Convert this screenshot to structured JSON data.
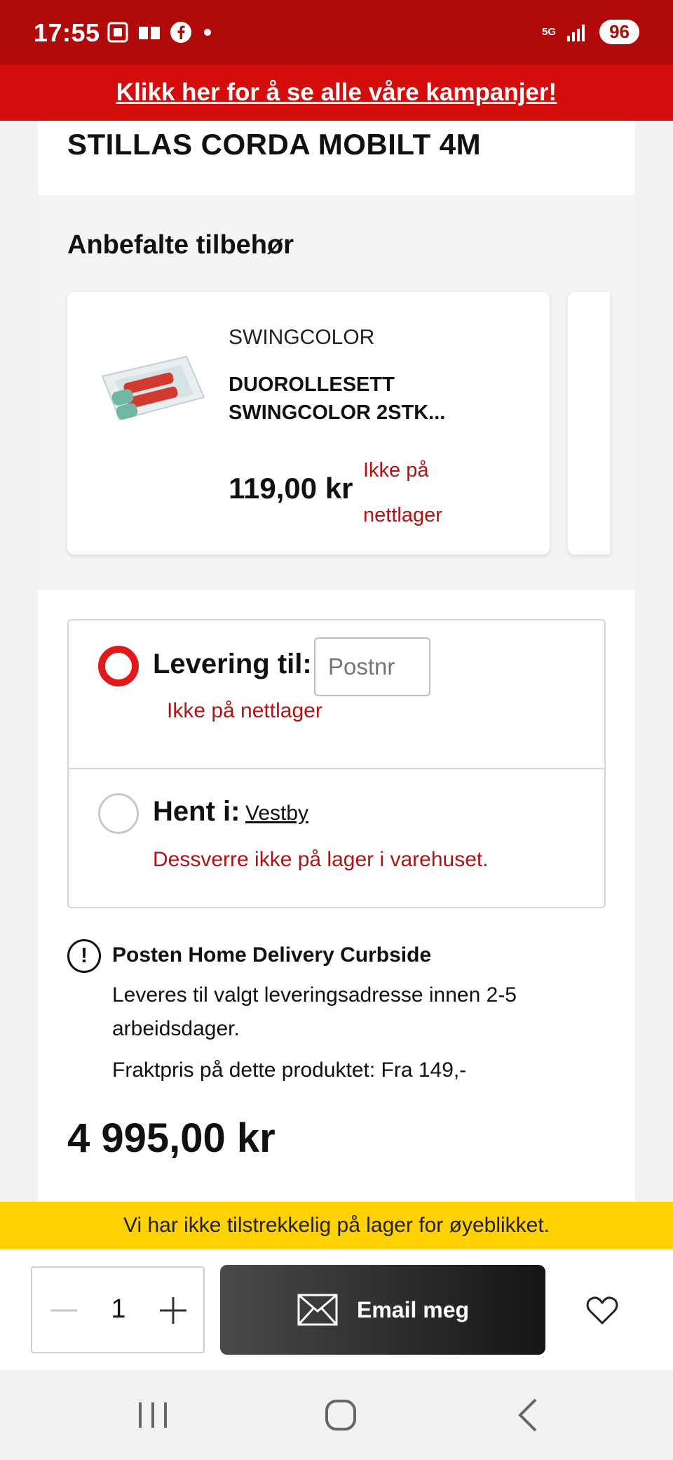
{
  "status_bar": {
    "time": "17:55",
    "network": "5G",
    "battery": "96"
  },
  "campaign_banner": {
    "text": "Klikk her for å se alle våre kampanjer!"
  },
  "product": {
    "title": "STILLAS CORDA MOBILT 4M",
    "price": "4 995,00 kr"
  },
  "accessories": {
    "heading": "Anbefalte tilbehør",
    "items": [
      {
        "brand": "SWINGCOLOR",
        "name": "DUOROLLESETT SWINGCOLOR 2STK...",
        "price": "119,00 kr",
        "stock": "Ikke på nettlager"
      }
    ]
  },
  "delivery": {
    "deliver_label": "Levering til:",
    "postnr_placeholder": "Postnr",
    "deliver_note": "Ikke på nettlager",
    "pickup_label": "Hent i:",
    "pickup_store": "Vestby",
    "pickup_note": "Dessverre ikke på lager i varehuset."
  },
  "shipping_info": {
    "title": "Posten Home Delivery Curbside",
    "text": "Leveres til valgt leveringsadresse innen 2-5 arbeidsdager.",
    "freight": "Fraktpris på dette produktet: Fra 149,-"
  },
  "stock_banner": {
    "text": "Vi har ikke tilstrekkelig på lager for øyeblikket."
  },
  "action_bar": {
    "quantity": "1",
    "email_label": "Email meg"
  },
  "colors": {
    "brand_red": "#d50d0d",
    "status_red": "#b10a0a",
    "warning_yellow": "#ffd200",
    "error_text": "#b41212"
  }
}
